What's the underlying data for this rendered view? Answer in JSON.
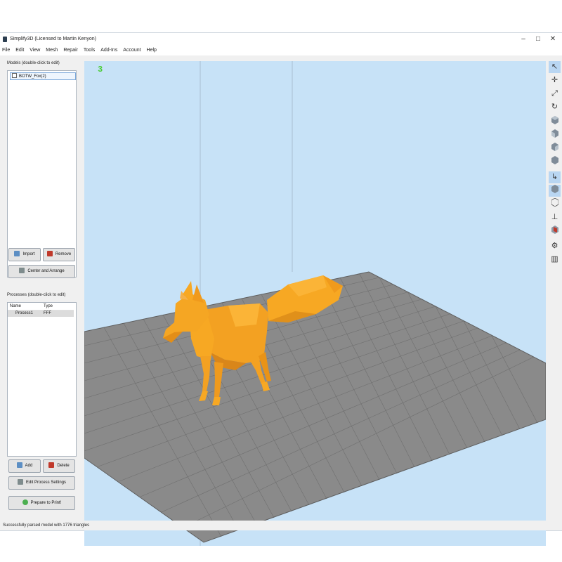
{
  "window": {
    "title": "Simplify3D (Licensed to Martin Kenyon)",
    "controls": {
      "minimize": "–",
      "maximize": "□",
      "close": "✕"
    }
  },
  "menu": [
    "File",
    "Edit",
    "View",
    "Mesh",
    "Repair",
    "Tools",
    "Add-Ins",
    "Account",
    "Help"
  ],
  "models": {
    "label": "Models (double-click to edit)",
    "items": [
      "BOTW_Fox(2)"
    ],
    "buttons": {
      "import": "Import",
      "remove": "Remove",
      "center": "Center and Arrange"
    }
  },
  "processes": {
    "label": "Processes (double-click to edit)",
    "columns": [
      "Name",
      "Type"
    ],
    "rows": [
      {
        "name": "Process1",
        "type": "FFF"
      }
    ],
    "buttons": {
      "add": "Add",
      "delete": "Delete",
      "edit": "Edit Process Settings",
      "prepare": "Prepare to Print!"
    }
  },
  "viewport": {
    "layer": "3",
    "colors": {
      "background": "#c7e2f7",
      "bed": "#8a8a8a",
      "grid": "#6f6f6f",
      "model": "#f5a623"
    }
  },
  "toolbar_icons": [
    "pointer-icon",
    "move-icon",
    "scale-icon",
    "rotate-icon",
    "view-cube-top-icon",
    "view-cube-front-icon",
    "view-cube-right-icon",
    "view-cube-iso-icon",
    "select-icon",
    "solid-view-icon",
    "wireframe-view-icon",
    "axis-icon",
    "cross-section-icon",
    "settings-gear-icon",
    "build-volume-icon"
  ],
  "status": "Successfully parsed model with 1776 triangles"
}
